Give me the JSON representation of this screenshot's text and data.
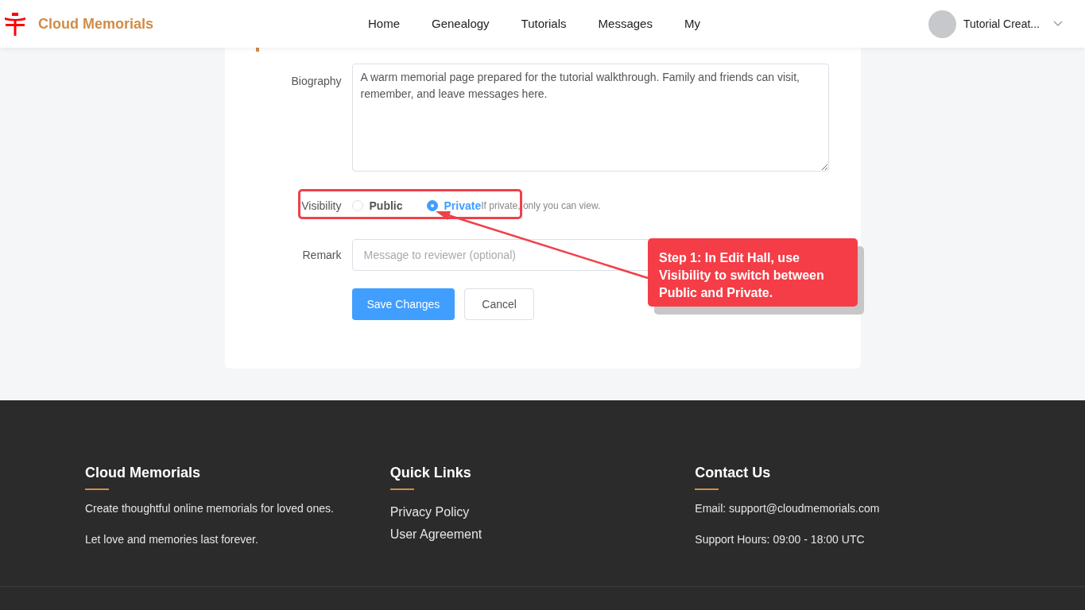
{
  "header": {
    "brand": "Cloud Memorials",
    "nav": [
      {
        "label": "Home",
        "selected": false
      },
      {
        "label": "Genealogy",
        "selected": false
      },
      {
        "label": "Tutorials",
        "selected": false
      },
      {
        "label": "Messages",
        "selected": false
      },
      {
        "label": "My",
        "selected": false
      }
    ],
    "user": "Tutorial Creat..."
  },
  "form": {
    "biography": {
      "label": "Biography",
      "value": "A warm memorial page prepared for the tutorial walkthrough. Family and friends can visit, remember, and leave messages here."
    },
    "visibility": {
      "label": "Visibility",
      "options": [
        {
          "label": "Public",
          "selected": false
        },
        {
          "label": "Private",
          "selected": true
        }
      ],
      "hint": "If private, only you can view."
    },
    "remark": {
      "label": "Remark",
      "placeholder": "Message to reviewer (optional)"
    },
    "buttons": [
      {
        "label": "Save Changes",
        "kind": "primary"
      },
      {
        "label": "Cancel",
        "kind": "default"
      }
    ]
  },
  "annotation": {
    "text": "Step 1: In Edit Hall, use Visibility to switch between Public and Private."
  },
  "footer": {
    "columns": [
      {
        "title": "Cloud Memorials",
        "lines": [
          "Create thoughtful online memorials for loved ones.",
          "Let love and memories last forever."
        ],
        "kind": "text"
      },
      {
        "title": "Quick Links",
        "lines": [
          "Privacy Policy",
          "User Agreement"
        ],
        "kind": "links"
      },
      {
        "title": "Contact Us",
        "lines": [
          "Email: support@cloudmemorials.com",
          "Support Hours: 09:00 - 18:00 UTC"
        ],
        "kind": "text"
      }
    ]
  }
}
